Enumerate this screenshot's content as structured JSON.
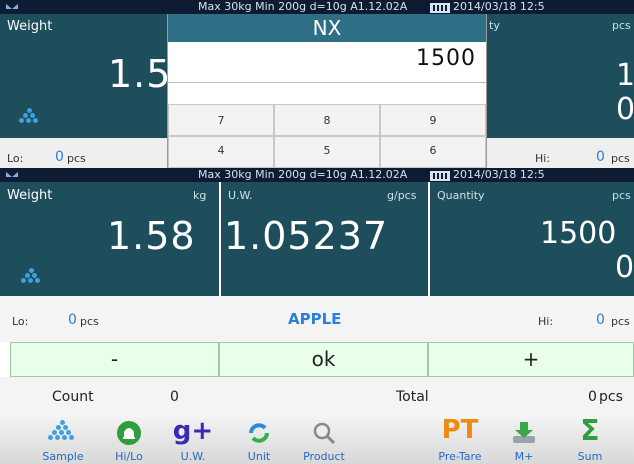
{
  "status_bar": {
    "info": "Max 30kg  Min 200g  d=10g    A1.12.02A",
    "datetime": "2014/03/18  12:5"
  },
  "popup": {
    "title": "NX",
    "entry_value": "1500",
    "keys": [
      "7",
      "8",
      "9",
      "4",
      "5",
      "6"
    ]
  },
  "top_panels": {
    "weight_label": "Weight",
    "weight_value": "1.5",
    "right_label": "ty",
    "right_unit": "pcs",
    "right_value_1": "1",
    "right_value_2": "0",
    "lo_label": "Lo:",
    "lo_value": "0",
    "lo_unit": "pcs",
    "hi_label": "Hi:",
    "hi_value": "0",
    "hi_unit": "pcs"
  },
  "main": {
    "weight_label": "Weight",
    "weight_unit": "kg",
    "weight_value": "1.58",
    "uw_label": "U.W.",
    "uw_unit": "g/pcs",
    "uw_value": "1.05237",
    "qty_label": "Quantity",
    "qty_unit": "pcs",
    "qty_value": "1500",
    "qty_value_2": "0",
    "lo_label": "Lo:",
    "lo_value": "0",
    "lo_unit": "pcs",
    "product_name": "APPLE",
    "hi_label": "Hi:",
    "hi_value": "0",
    "hi_unit": "pcs"
  },
  "buttons": {
    "minus": "-",
    "ok": "ok",
    "plus": "+"
  },
  "summary": {
    "count_label": "Count",
    "count_value": "0",
    "total_label": "Total",
    "total_value": "0",
    "total_unit": "pcs"
  },
  "toolbar": [
    {
      "label": "Sample",
      "icon": "sample-icon"
    },
    {
      "label": "Hi/Lo",
      "icon": "bell-icon"
    },
    {
      "label": "U.W.",
      "icon": "gplus-icon"
    },
    {
      "label": "Unit",
      "icon": "refresh-icon"
    },
    {
      "label": "Product",
      "icon": "magnifier-icon"
    },
    {
      "label": "Pre-Tare",
      "icon": "pt-icon"
    },
    {
      "label": "M+",
      "icon": "download-icon"
    },
    {
      "label": "Sum",
      "icon": "sigma-icon"
    }
  ],
  "colors": {
    "panel": "#1e4d5c",
    "accent": "#2a7fd8",
    "status": "#0e1c33"
  }
}
